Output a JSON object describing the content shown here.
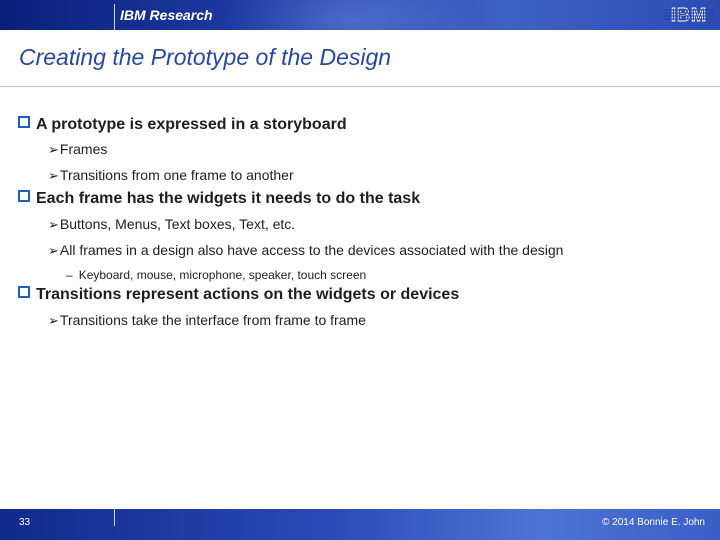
{
  "header": {
    "org_label": "IBM Research",
    "logo_text": "IBM"
  },
  "slide": {
    "title": "Creating the Prototype of the Design",
    "bullets": [
      {
        "text": "A prototype is expressed in a storyboard",
        "subs": [
          "Frames",
          "Transitions from one frame to another"
        ]
      },
      {
        "text": "Each frame has the widgets it needs to do the task",
        "subs": [
          "Buttons, Menus, Text boxes, Text, etc.",
          "All frames in a design also have access to the devices associated with the design"
        ],
        "subsubs": [
          "Keyboard, mouse, microphone, speaker, touch screen"
        ]
      },
      {
        "text": "Transitions represent actions on the widgets or devices",
        "subs": [
          "Transitions take the interface from frame to frame"
        ]
      }
    ]
  },
  "footer": {
    "page_number": "33",
    "copyright": "© 2014 Bonnie E. John"
  },
  "colors": {
    "header_bar": "#1f3da8",
    "title_text": "#2848a0",
    "bullet_box": "#1f5fbf"
  },
  "icons": {
    "bullet": "hollow-square-icon",
    "sub_bullet": "arrow-bullet-icon",
    "logo": "ibm-logo-icon"
  }
}
